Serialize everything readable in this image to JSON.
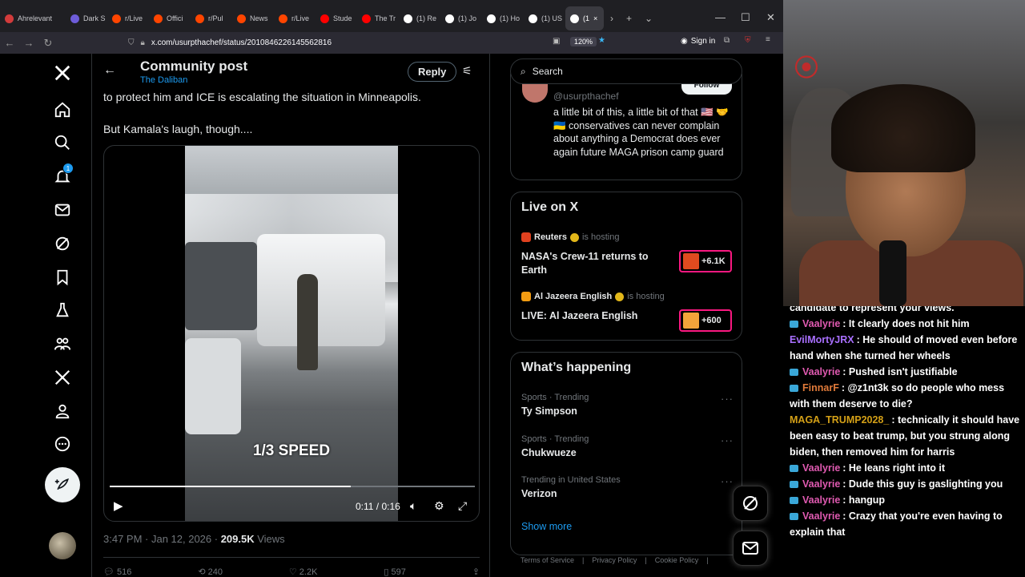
{
  "browser": {
    "tabs": [
      {
        "label": "Ahrelevant",
        "color": "#d23b3b"
      },
      {
        "label": "Dark S",
        "color": "#6d5cd9"
      },
      {
        "label": "r/Live",
        "color": "#ff4500"
      },
      {
        "label": "Offici",
        "color": "#ff4500"
      },
      {
        "label": "r/Pul",
        "color": "#ff4500"
      },
      {
        "label": "News",
        "color": "#ff4500"
      },
      {
        "label": "r/Live",
        "color": "#ff4500"
      },
      {
        "label": "Stude",
        "color": "#ff0000"
      },
      {
        "label": "The Tr",
        "color": "#ff0000"
      },
      {
        "label": "(1) Re",
        "color": "#ffffff"
      },
      {
        "label": "(1) Jo",
        "color": "#ffffff"
      },
      {
        "label": "(1) Ho",
        "color": "#ffffff"
      },
      {
        "label": "(1) US",
        "color": "#ffffff"
      },
      {
        "label": "(1",
        "color": "#ffffff"
      }
    ],
    "url": "x.com/usurpthachef/status/2010846226145562816",
    "zoom": "120%",
    "signin": "Sign in"
  },
  "nav": {
    "notification_count": "1"
  },
  "main": {
    "title": "Community post",
    "subtitle": "The Daliban",
    "reply_label": "Reply",
    "post_line1": "to protect him and ICE is escalating the situation in Minneapolis.",
    "post_line2": "But Kamala's laugh, though....",
    "video_caption": "1/3 SPEED",
    "video_time": "0:11 / 0:16",
    "video_progress": 0.66,
    "post_time": "3:47 PM · Jan 12, 2026 · ",
    "views_count": "209.5K",
    "views_label": " Views",
    "actions": [
      "516",
      "240",
      "2.2K",
      "597"
    ]
  },
  "right": {
    "search_placeholder": "Search",
    "user_handle": "@usurpthachef",
    "follow_label": "Follow",
    "user_bio": "a little bit of this, a little bit of that 🇺🇸 🤝🇺🇦 conservatives can never complain about anything a Democrat does ever again future MAGA prison camp guard",
    "live_title": "Live on X",
    "live": [
      {
        "host": "Reuters",
        "hosting": "is hosting",
        "title": "NASA's Crew-11 returns to Earth",
        "count": "+6.1K",
        "host_color": "#e0411f",
        "thumb_color": "#e04b1f"
      },
      {
        "host": "Al Jazeera English",
        "hosting": "is hosting",
        "title": "LIVE: Al Jazeera English",
        "count": "+600",
        "host_color": "#f39c12",
        "thumb_color": "#f2a43a"
      }
    ],
    "happening_title": "What’s happening",
    "trends": [
      {
        "meta": "Sports · Trending",
        "name": "Ty Simpson"
      },
      {
        "meta": "Sports · Trending",
        "name": "Chukwueze"
      },
      {
        "meta": "Trending in United States",
        "name": "Verizon"
      }
    ],
    "show_more": "Show more",
    "footer": [
      "Terms of Service",
      "|",
      "Privacy Policy",
      "|",
      "Cookie Policy",
      "|"
    ]
  },
  "stream": {
    "chat": [
      {
        "user": "",
        "text": "candidate to represent your views.",
        "color": "#ffffff",
        "badge": false
      },
      {
        "user": "Vaalyrie",
        "text": ": It clearly does not hit him",
        "color": "#e05ab1",
        "badge": true
      },
      {
        "user": "EvilMortyJRX",
        "text": ": He should of moved even before hand when she turned her wheels",
        "color": "#a970ff",
        "badge": false
      },
      {
        "user": "Vaalyrie",
        "text": ": Pushed isn't justifiable",
        "color": "#e05ab1",
        "badge": true
      },
      {
        "user": "FinnarF",
        "text": ": @z1nt3k so do people who mess with them deserve to die?",
        "color": "#e07a3a",
        "badge": true
      },
      {
        "user": "MAGA_TRUMP2028_",
        "text": ": technically it should have been easy to beat trump, but you strung along biden, then removed him for harris",
        "color": "#d4a017",
        "badge": false
      },
      {
        "user": "Vaalyrie",
        "text": ": He leans right into it",
        "color": "#e05ab1",
        "badge": true
      },
      {
        "user": "Vaalyrie",
        "text": ": Dude this guy is gaslighting you",
        "color": "#e05ab1",
        "badge": true
      },
      {
        "user": "Vaalyrie",
        "text": ": hangup",
        "color": "#e05ab1",
        "badge": true
      },
      {
        "user": "Vaalyrie",
        "text": ": Crazy that you're even having to explain that",
        "color": "#e05ab1",
        "badge": true
      }
    ]
  }
}
